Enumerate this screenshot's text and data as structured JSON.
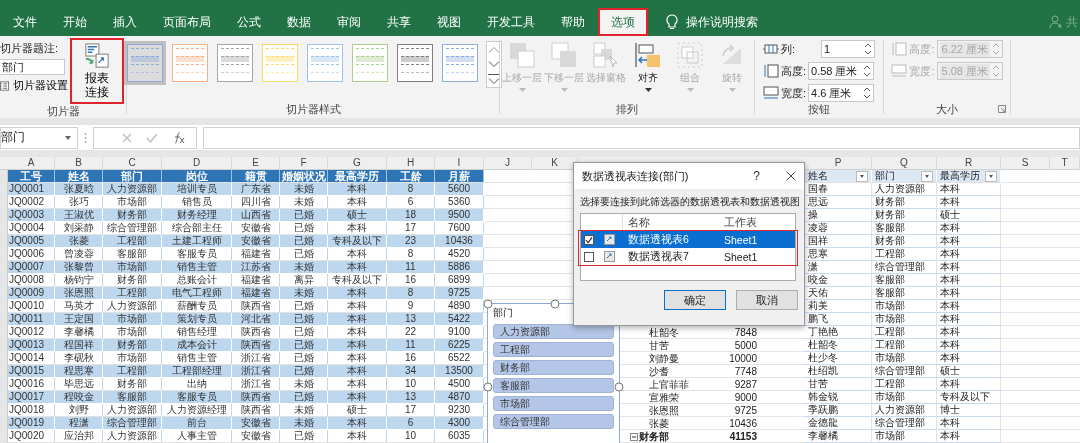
{
  "tabs": [
    {
      "label": "文件",
      "selected": false,
      "highlighted": false
    },
    {
      "label": "开始",
      "selected": false,
      "highlighted": false
    },
    {
      "label": "插入",
      "selected": false,
      "highlighted": false
    },
    {
      "label": "页面布局",
      "selected": false,
      "highlighted": false
    },
    {
      "label": "公式",
      "selected": false,
      "highlighted": false
    },
    {
      "label": "数据",
      "selected": false,
      "highlighted": false
    },
    {
      "label": "审阅",
      "selected": false,
      "highlighted": false
    },
    {
      "label": "共享",
      "selected": false,
      "highlighted": false
    },
    {
      "label": "视图",
      "selected": false,
      "highlighted": false
    },
    {
      "label": "开发工具",
      "selected": false,
      "highlighted": false
    },
    {
      "label": "帮助",
      "selected": false,
      "highlighted": false
    },
    {
      "label": "选项",
      "selected": true,
      "highlighted": true
    }
  ],
  "tell_me": "操作说明搜索",
  "share": "共",
  "ribbon": {
    "slicer_group": {
      "caption_label": "切片器题注:",
      "caption_value": "部门",
      "settings": "切片器设置",
      "report_connections": {
        "label": "报表连接",
        "highlighted": true
      },
      "label": "切片器"
    },
    "styles_group": {
      "label": "切片器样式",
      "styles": [
        {
          "color": "#8eaadb",
          "selected": true
        },
        {
          "color": "#f4b183",
          "selected": false
        },
        {
          "color": "#a5a5a5",
          "selected": false
        },
        {
          "color": "#ffd966",
          "selected": false
        },
        {
          "color": "#9dc3e6",
          "selected": false
        },
        {
          "color": "#a9d08e",
          "selected": false
        },
        {
          "color": "#7f7f7f",
          "selected": false
        },
        {
          "color": "#8faadc",
          "selected": false
        }
      ]
    },
    "arrange_group": {
      "label": "排列",
      "buttons": [
        {
          "kind": "forward",
          "label": "上移一层",
          "disabled": true,
          "dropdown": true
        },
        {
          "kind": "backward",
          "label": "下移一层",
          "disabled": true,
          "dropdown": true
        },
        {
          "kind": "pane",
          "label": "选择窗格",
          "disabled": true,
          "dropdown": false
        },
        {
          "kind": "align",
          "label": "对齐",
          "disabled": false,
          "dropdown": true
        },
        {
          "kind": "group",
          "label": "组合",
          "disabled": true,
          "dropdown": true
        },
        {
          "kind": "rotate",
          "label": "旋转",
          "disabled": true,
          "dropdown": true
        }
      ]
    },
    "buttons_group": {
      "label": "按钮",
      "fields": [
        {
          "kind": "columns",
          "label": "列:",
          "value": "1",
          "disabled": false
        },
        {
          "kind": "height",
          "label": "高度:",
          "value": "0.58 厘米",
          "disabled": false
        },
        {
          "kind": "width",
          "label": "宽度:",
          "value": "4.6 厘米",
          "disabled": false
        }
      ]
    },
    "size_group": {
      "label": "大小",
      "fields": [
        {
          "kind": "height",
          "label": "高度:",
          "value": "6.22 厘米",
          "disabled": true
        },
        {
          "kind": "width",
          "label": "宽度:",
          "value": "5.08 厘米",
          "disabled": true
        }
      ]
    }
  },
  "name_box": "部门",
  "column_headers_left": [
    "A",
    "B",
    "C",
    "D",
    "E",
    "F",
    "G",
    "H",
    "I",
    "J",
    "K"
  ],
  "column_headers_right": [
    "P",
    "Q",
    "R",
    "S",
    "T"
  ],
  "table": {
    "headers": [
      "工号",
      "姓名",
      "部门",
      "岗位",
      "籍贯",
      "婚姻状况",
      "最高学历",
      "工龄",
      "月薪"
    ],
    "rows": [
      [
        "JQ0001",
        "张夏晗",
        "人力资源部",
        "培训专员",
        "广东省",
        "未婚",
        "本科",
        "8",
        "5600"
      ],
      [
        "JQ0002",
        "张巧",
        "市场部",
        "销售员",
        "四川省",
        "未婚",
        "本科",
        "6",
        "5360"
      ],
      [
        "JQ0003",
        "王淑优",
        "财务部",
        "财务经理",
        "山西省",
        "已婚",
        "硕士",
        "18",
        "9500"
      ],
      [
        "JQ0004",
        "刘采静",
        "综合管理部",
        "综合部主任",
        "安徽省",
        "已婚",
        "本科",
        "17",
        "7600"
      ],
      [
        "JQ0005",
        "张菱",
        "工程部",
        "土建工程师",
        "安徽省",
        "已婚",
        "专科及以下",
        "23",
        "10436"
      ],
      [
        "JQ0006",
        "曾凌蓉",
        "客服部",
        "客服专员",
        "福建省",
        "已婚",
        "本科",
        "8",
        "4520"
      ],
      [
        "JQ0007",
        "张黎曾",
        "市场部",
        "销售主管",
        "江苏省",
        "未婚",
        "本科",
        "11",
        "5886"
      ],
      [
        "JQ0008",
        "杨钧宁",
        "财务部",
        "总账会计",
        "福建省",
        "离异",
        "专科及以下",
        "16",
        "6899"
      ],
      [
        "JQ0009",
        "张恩照",
        "工程部",
        "电气工程师",
        "福建省",
        "未婚",
        "本科",
        "8",
        "9725"
      ],
      [
        "JQ0010",
        "马英才",
        "人力资源部",
        "薪酬专员",
        "陕西省",
        "已婚",
        "本科",
        "9",
        "4890"
      ],
      [
        "JQ0011",
        "王定国",
        "市场部",
        "策划专员",
        "河北省",
        "已婚",
        "本科",
        "13",
        "5422"
      ],
      [
        "JQ0012",
        "李馨橘",
        "市场部",
        "销售经理",
        "陕西省",
        "已婚",
        "本科",
        "22",
        "9100"
      ],
      [
        "JQ0013",
        "程国祥",
        "财务部",
        "成本会计",
        "陕西省",
        "已婚",
        "本科",
        "11",
        "6225"
      ],
      [
        "JQ0014",
        "李砚秋",
        "市场部",
        "销售主管",
        "浙江省",
        "已婚",
        "本科",
        "16",
        "6522"
      ],
      [
        "JQ0015",
        "程思寒",
        "工程部",
        "工程部经理",
        "浙江省",
        "已婚",
        "本科",
        "34",
        "13500"
      ],
      [
        "JQ0016",
        "毕思远",
        "财务部",
        "出纳",
        "浙江省",
        "未婚",
        "本科",
        "10",
        "4500"
      ],
      [
        "JQ0017",
        "程咬金",
        "客服部",
        "客服专员",
        "陕西省",
        "已婚",
        "本科",
        "13",
        "4870"
      ],
      [
        "JQ0018",
        "刘野",
        "人力资源部",
        "人力资源经理",
        "陕西省",
        "未婚",
        "硕士",
        "17",
        "9230"
      ],
      [
        "JQ0019",
        "程潇",
        "综合管理部",
        "前台",
        "安徽省",
        "未婚",
        "本科",
        "6",
        "4300"
      ],
      [
        "JQ0020",
        "应治邦",
        "人力资源部",
        "人事主管",
        "安徽省",
        "已婚",
        "本科",
        "10",
        "6035"
      ]
    ]
  },
  "pivot": {
    "rows": [
      {
        "kind": "item",
        "name": "杜韶冬",
        "value": "7848"
      },
      {
        "kind": "item",
        "name": "甘苦",
        "value": "5000"
      },
      {
        "kind": "item",
        "name": "刘静曼",
        "value": "10000"
      },
      {
        "kind": "item",
        "name": "沙耆",
        "value": "7748"
      },
      {
        "kind": "item",
        "name": "上官菲菲",
        "value": "9287"
      },
      {
        "kind": "item",
        "name": "宣雅荣",
        "value": "9000"
      },
      {
        "kind": "item",
        "name": "张恩照",
        "value": "9725"
      },
      {
        "kind": "item",
        "name": "张菱",
        "value": "10436"
      },
      {
        "kind": "subtotal",
        "name": "财务部",
        "value": "41153"
      }
    ]
  },
  "right_table": {
    "headers": [
      "姓名",
      "部门",
      "最高学历"
    ],
    "rows": [
      [
        "国春",
        "人力资源部",
        "本科"
      ],
      [
        "思远",
        "财务部",
        "本科"
      ],
      [
        "操",
        "财务部",
        "硕士"
      ],
      [
        "凌蓉",
        "客服部",
        "本科"
      ],
      [
        "国祥",
        "财务部",
        "本科"
      ],
      [
        "思寒",
        "工程部",
        "本科"
      ],
      [
        "潇",
        "综合管理部",
        "本科"
      ],
      [
        "咬金",
        "客服部",
        "本科"
      ],
      [
        "天佑",
        "客服部",
        "本科"
      ],
      [
        "莉美",
        "市场部",
        "本科"
      ],
      [
        "鹏飞",
        "市场部",
        "本科"
      ],
      [
        "丁艳艳",
        "工程部",
        "本科"
      ],
      [
        "杜韶冬",
        "工程部",
        "本科"
      ],
      [
        "杜少冬",
        "市场部",
        "本科"
      ],
      [
        "杜绍凯",
        "综合管理部",
        "硕士"
      ],
      [
        "甘苦",
        "工程部",
        "本科"
      ],
      [
        "韩金锐",
        "市场部",
        "专科及以下"
      ],
      [
        "季跃鹏",
        "人力资源部",
        "博士"
      ],
      [
        "金德龍",
        "综合管理部",
        "本科"
      ],
      [
        "李馨橘",
        "市场部",
        "本科"
      ]
    ]
  },
  "slicer": {
    "title": "部门",
    "items": [
      {
        "label": "人力资源部",
        "selected": true
      },
      {
        "label": "工程部",
        "selected": true
      },
      {
        "label": "财务部",
        "selected": true
      },
      {
        "label": "客服部",
        "selected": true
      },
      {
        "label": "市场部",
        "selected": true
      },
      {
        "label": "综合管理部",
        "selected": true
      }
    ]
  },
  "dialog": {
    "title": "数据透视表连接(部门)",
    "help": "?",
    "instruction": "选择要连接到此筛选器的数据透视表和数据透视图",
    "columns": [
      "名称",
      "工作表"
    ],
    "rows_highlighted": true,
    "rows": [
      {
        "name": "数据透视表6",
        "sheet": "Sheet1",
        "checked": true,
        "selected": true
      },
      {
        "name": "数据透视表7",
        "sheet": "Sheet1",
        "checked": false,
        "selected": false
      }
    ],
    "ok": "确定",
    "cancel": "取消"
  }
}
